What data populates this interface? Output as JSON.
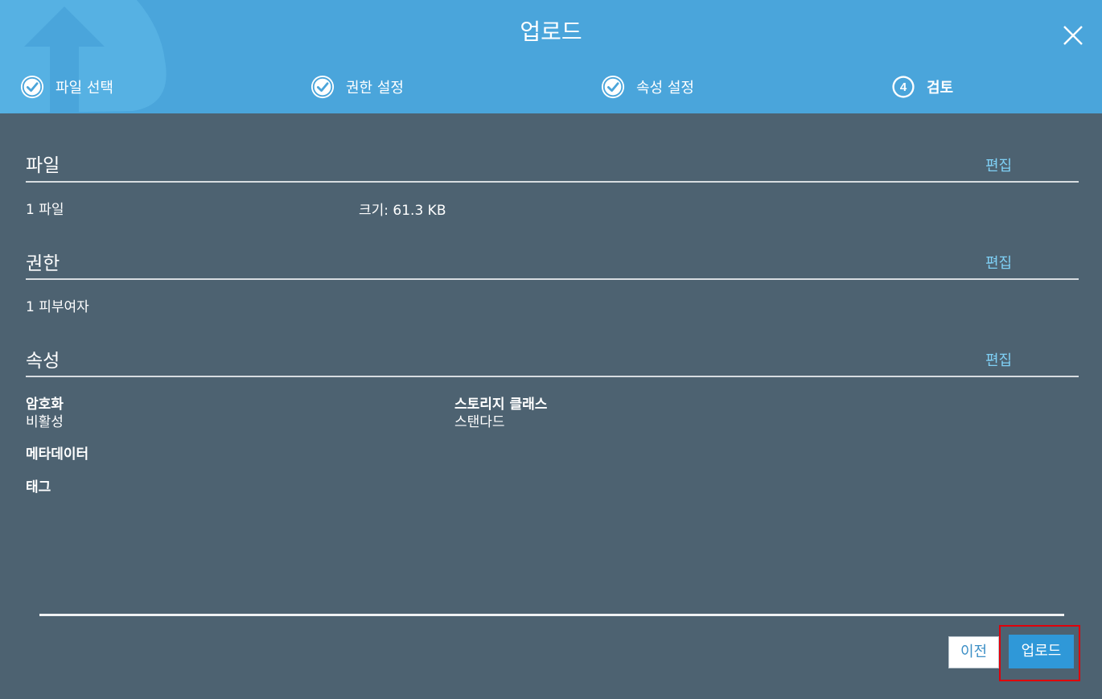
{
  "dialog": {
    "title": "업로드"
  },
  "steps": [
    {
      "number": "1",
      "label": "파일 선택",
      "state": "complete"
    },
    {
      "number": "2",
      "label": "권한 설정",
      "state": "complete"
    },
    {
      "number": "3",
      "label": "속성 설정",
      "state": "complete"
    },
    {
      "number": "4",
      "label": "검토",
      "state": "active"
    }
  ],
  "sections": {
    "files": {
      "title": "파일",
      "edit_label": "편집",
      "count_text": "1 파일",
      "size_text": "크기: 61.3 KB"
    },
    "permissions": {
      "title": "권한",
      "edit_label": "편집",
      "grantees_text": "1 피부여자"
    },
    "properties": {
      "title": "속성",
      "edit_label": "편집",
      "encryption_label": "암호화",
      "encryption_value": "비활성",
      "storage_class_label": "스토리지 클래스",
      "storage_class_value": "스탠다드",
      "metadata_label": "메타데이터",
      "tags_label": "태그"
    }
  },
  "footer": {
    "prev_label": "이전",
    "upload_label": "업로드"
  },
  "colors": {
    "header_bg": "#4aa5db",
    "body_bg": "#4d6271",
    "link": "#7fd0f5",
    "primary_button": "#2f98d8",
    "highlight": "#e0000a"
  }
}
